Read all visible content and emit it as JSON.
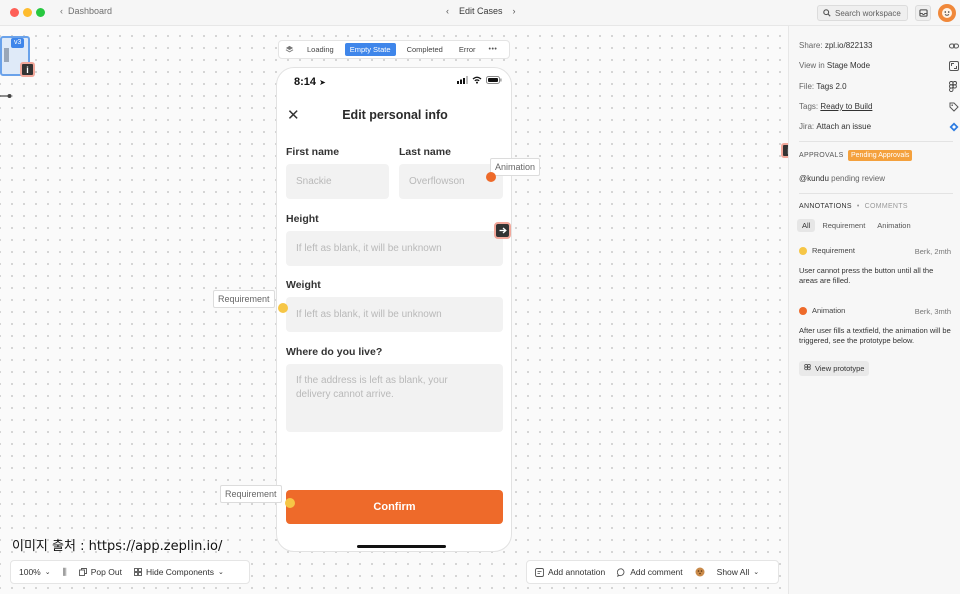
{
  "titlebar": {
    "back_label": "Dashboard",
    "screen_title": "Edit Cases",
    "search_placeholder": "Search workspace"
  },
  "canvas": {
    "thumb_version": "v3",
    "states": [
      "Loading",
      "Empty State",
      "Completed",
      "Error"
    ],
    "active_state": "Empty State",
    "more_label": "•••"
  },
  "phone": {
    "time": "8:14",
    "title": "Edit personal info",
    "first_name_label": "First name",
    "first_name_placeholder": "Snackie",
    "last_name_label": "Last name",
    "last_name_placeholder": "Overflowson",
    "height_label": "Height",
    "height_placeholder": "If left as blank, it will be unknown",
    "weight_label": "Weight",
    "weight_placeholder": "If left as blank, it will be unknown",
    "address_label": "Where do you live?",
    "address_placeholder": "If the address is left as blank, your delivery cannot arrive.",
    "confirm_label": "Confirm"
  },
  "annotations_on_canvas": {
    "animation": "Animation",
    "requirement_weight": "Requirement",
    "requirement_confirm": "Requirement"
  },
  "credit": "이미지 출처 : https://app.zeplin.io/",
  "bottom_left": {
    "zoom": "100%",
    "pop_out": "Pop Out",
    "hide_components": "Hide Components"
  },
  "bottom_right": {
    "add_annotation": "Add annotation",
    "add_comment": "Add comment",
    "show_all": "Show All"
  },
  "panel": {
    "share_label": "Share:",
    "share_value": "zpl.io/822133",
    "stage_prefix": "View in",
    "stage_value": "Stage Mode",
    "file_label": "File:",
    "file_value": "Tags 2.0",
    "tags_label": "Tags:",
    "tags_value": "Ready to Build",
    "jira_label": "Jira:",
    "jira_value": "Attach an issue",
    "approvals_title": "APPROVALS",
    "approvals_badge": "Pending Approvals",
    "review_user": "@kundu",
    "review_text": "pending review",
    "annotations_title": "ANNOTATIONS",
    "comments_title": "COMMENTS",
    "filters": [
      "All",
      "Requirement",
      "Animation"
    ],
    "items": [
      {
        "type": "Requirement",
        "author": "Berk, 2mth",
        "text": "User cannot press the button until all the areas are filled."
      },
      {
        "type": "Animation",
        "author": "Berk, 3mth",
        "text": "After user fills a textfield, the animation will be triggered, see the prototype below."
      }
    ],
    "view_prototype": "View prototype"
  },
  "colors": {
    "accent_orange": "#ee6a2a",
    "requirement_yellow": "#f6c646",
    "state_blue": "#3f86ea",
    "badge_orange": "#f4a13d"
  }
}
